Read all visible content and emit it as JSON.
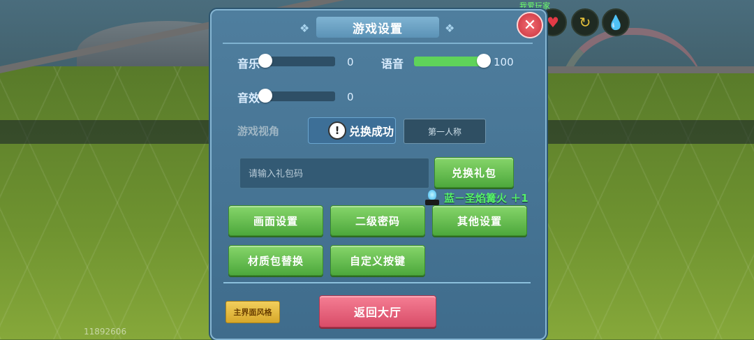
{
  "hud": {
    "player_name": "我爱玩家",
    "icons": [
      "heart-icon",
      "arrow-icon",
      "water-drop-icon"
    ],
    "bottom_id": "11892606"
  },
  "settings": {
    "title": "游戏设置",
    "close_label": "✕",
    "music": {
      "label": "音乐",
      "value": "0",
      "level": 0
    },
    "voice": {
      "label": "语音",
      "value": "100",
      "level": 100
    },
    "sfx": {
      "label": "音效",
      "value": "0",
      "level": 0
    },
    "view": {
      "label": "游戏视角",
      "first_person": "第一人称"
    },
    "toast": {
      "icon": "!",
      "text": "兑换成功"
    },
    "gift": {
      "placeholder": "请输入礼包码",
      "button": "兑换礼包",
      "reward": "蓝－圣焰篝火 ＋1"
    },
    "buttons": {
      "display": "画面设置",
      "secondary_password": "二级密码",
      "other": "其他设置",
      "texture_pack": "材质包替换",
      "custom_keys": "自定义按键"
    },
    "main_style": "主界面风格",
    "return_lobby": "返回大厅"
  },
  "colors": {
    "panel": "#4a7798",
    "green_button": "#5cb847",
    "red_button": "#e55d77",
    "yellow_button": "#e8bd43",
    "slider_fill": "#5fd35a",
    "reward_text": "#56f26a"
  }
}
